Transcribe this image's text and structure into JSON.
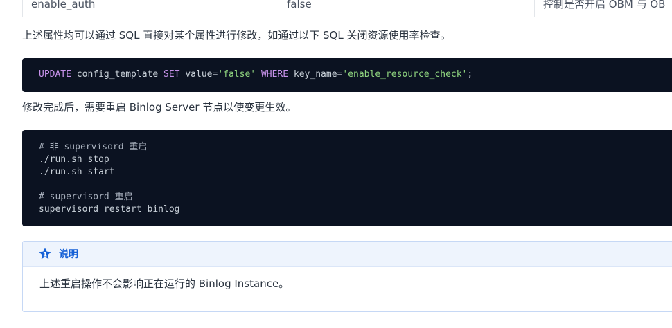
{
  "table": {
    "row": {
      "key": "enable_auth",
      "value": "false",
      "desc": "控制是否开启 OBM 与 OB"
    }
  },
  "paragraph1": "上述属性均可以通过 SQL 直接对某个属性进行修改，如通过以下 SQL 关闭资源使用率检查。",
  "code1": {
    "kw_update": "UPDATE",
    "t1": " config_template ",
    "kw_set": "SET",
    "t2": " value=",
    "s1": "'false'",
    "t3": " ",
    "kw_where": "WHERE",
    "t4": " key_name=",
    "s2": "'enable_resource_check'",
    "t5": ";"
  },
  "paragraph2": "修改完成后，需要重启 Binlog Server 节点以使变更生效。",
  "code2": {
    "lines": [
      "# 非 supervisord 重启",
      "./run.sh stop",
      "./run.sh start",
      "",
      "# supervisord 重启",
      "supervisord restart binlog"
    ]
  },
  "note": {
    "title": "说明",
    "body": "上述重启操作不会影响正在运行的 Binlog Instance。",
    "icon": "info-star-icon",
    "accent": "#1560d6"
  }
}
